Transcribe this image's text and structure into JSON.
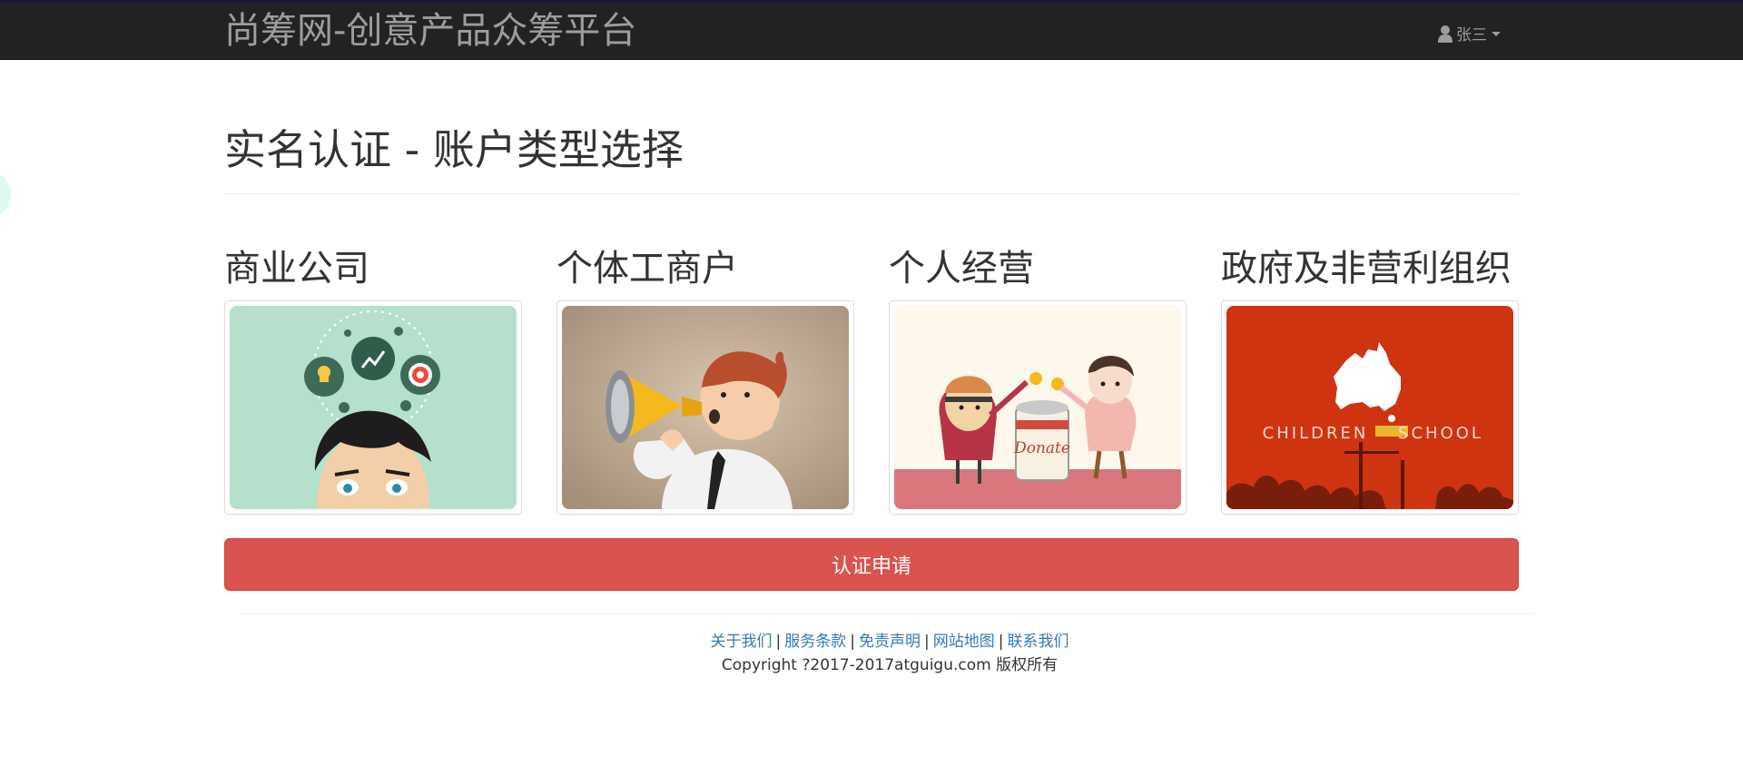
{
  "navbar": {
    "brand": "尚筹网-创意产品众筹平台",
    "user_name": "张三",
    "user_icon": "user-icon",
    "dropdown_icon": "caret-down-icon"
  },
  "page": {
    "title": "实名认证 - 账户类型选择"
  },
  "account_types": [
    {
      "label": "商业公司",
      "image": "business-idea-illustration"
    },
    {
      "label": "个体工商户",
      "image": "megaphone-man-illustration"
    },
    {
      "label": "个人经营",
      "image": "donate-can-illustration"
    },
    {
      "label": "政府及非营利组织",
      "image": "children-school-australia-illustration",
      "image_text_left": "CHILDREN",
      "image_text_right": "SCHOOL"
    }
  ],
  "actions": {
    "apply_label": "认证申请",
    "apply_color": "#d9534f"
  },
  "footer": {
    "links": [
      "关于我们",
      "服务条款",
      "免责声明",
      "网站地图",
      "联系我们"
    ],
    "separator": "|",
    "copyright": "Copyright ?2017-2017atguigu.com 版权所有"
  }
}
